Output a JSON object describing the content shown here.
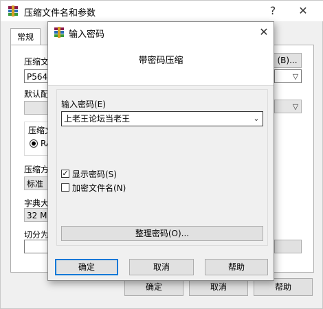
{
  "background_window": {
    "title": "压缩文件名和参数",
    "help_glyph": "?",
    "close_glyph": "✕",
    "tab_general": "常规",
    "archive_name_label": "压缩文",
    "archive_name_value": "P5640",
    "browse_button": "(B)...",
    "default_profile_label": "默认配",
    "format_group_label": "压缩文",
    "format_radio_label": "RA",
    "method_label": "压缩方",
    "method_value": "标准",
    "dict_label": "字典大",
    "dict_value": "32 MB",
    "split_label": "切分为",
    "ok_button": "确定",
    "cancel_button": "取消",
    "help_button": "帮助"
  },
  "dialog": {
    "title": "输入密码",
    "close_glyph": "✕",
    "header": "带密码压缩",
    "password_label": "输入密码(E)",
    "password_value": "上老王论坛当老王",
    "show_password_label": "显示密码(S)",
    "show_password_checked": true,
    "encrypt_names_label": "加密文件名(N)",
    "encrypt_names_checked": false,
    "organize_button": "整理密码(O)...",
    "ok_button": "确定",
    "cancel_button": "取消",
    "help_button": "帮助"
  },
  "colors": {
    "accent": "#0078d7",
    "window_bg": "#f0f0f0",
    "button_bg": "#e1e1e1"
  }
}
